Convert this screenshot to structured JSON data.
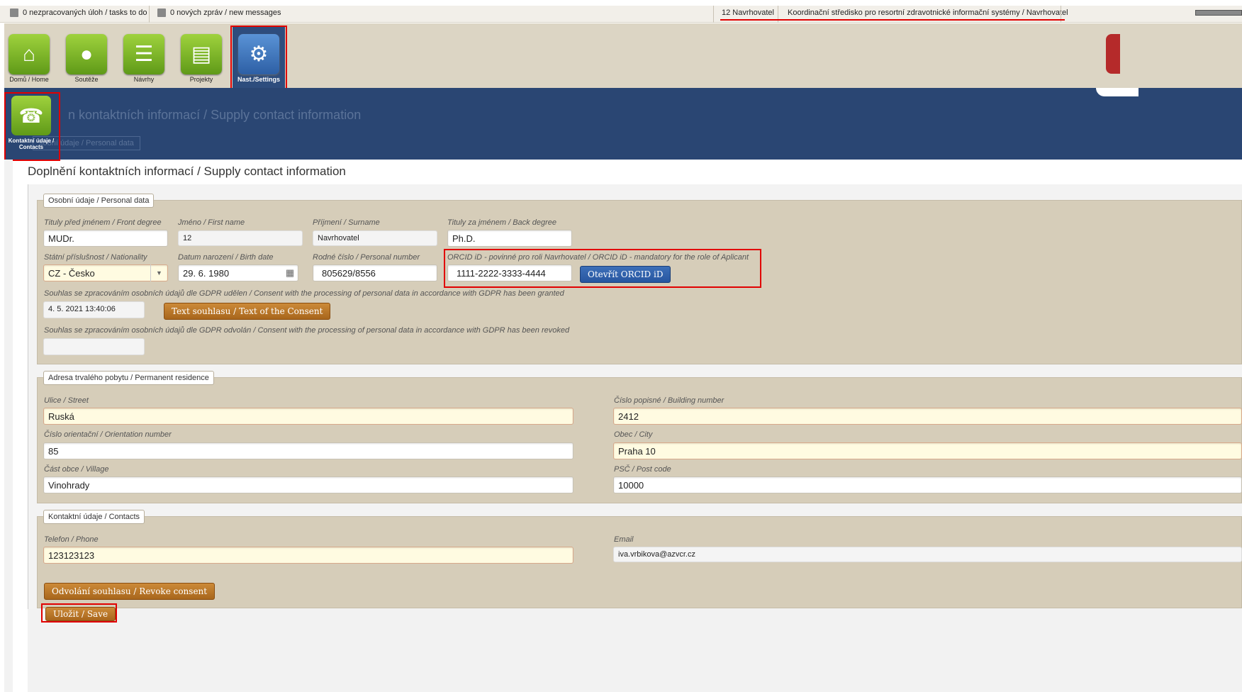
{
  "topbar": {
    "tasks": "0 nezpracovaných úloh / tasks to do",
    "messages": "0 nových zpráv / new messages",
    "user": "12 Navrhovatel",
    "org": "Koordinační středisko pro resortní zdravotnické informační systémy / Navrhovatel"
  },
  "toolbar": {
    "home": "Domů / Home",
    "competitions": "Soutěže",
    "proposals": "Návrhy",
    "projects": "Projekty",
    "settings": "Nast./Settings"
  },
  "subnav": {
    "contacts": "Kontaktní údaje / Contacts"
  },
  "band": {
    "title": "n kontaktních informací / Supply contact information",
    "chip": "sobní údaje / Personal data"
  },
  "page_title": "Doplnění kontaktních informací / Supply contact information",
  "personal": {
    "legend": "Osobní údaje / Personal data",
    "front_degree_label": "Tituly před jménem / Front degree",
    "front_degree": "MUDr.",
    "first_name_label": "Jméno / First name",
    "first_name": "12",
    "surname_label": "Příjmení / Surname",
    "surname": "Navrhovatel",
    "back_degree_label": "Tituly za jménem / Back degree",
    "back_degree": "Ph.D.",
    "nationality_label": "Státní příslušnost / Nationality",
    "nationality": "CZ - Česko",
    "birth_label": "Datum narození / Birth date",
    "birth": "29. 6. 1980",
    "pn_label": "Rodné číslo / Personal number",
    "pn": "805629/8556",
    "orcid_label": "ORCID iD - povinné pro roli Navrhovatel / ORCID iD - mandatory for the role of Aplicant",
    "orcid": "1111-2222-3333-4444",
    "orcid_button": "Otevřít ORCID iD",
    "gdpr_granted_label": "Souhlas se zpracováním osobních údajů dle GDPR udělen / Consent with the processing of personal data in accordance with GDPR has been granted",
    "gdpr_granted": "4. 5. 2021 13:40:06",
    "consent_button": "Text souhlasu / Text of the Consent",
    "gdpr_revoked_label": "Souhlas se zpracováním osobních údajů dle GDPR odvolán / Consent with the processing of personal data in accordance with GDPR has been revoked",
    "gdpr_revoked": ""
  },
  "address": {
    "legend": "Adresa trvalého pobytu / Permanent residence",
    "street_label": "Ulice / Street",
    "street": "Ruská",
    "building_label": "Číslo popisné / Building number",
    "building": "2412",
    "orientation_label": "Číslo orientační / Orientation number",
    "orientation": "85",
    "city_label": "Obec / City",
    "city": "Praha 10",
    "village_label": "Část obce / Village",
    "village": "Vinohrady",
    "postcode_label": "PSČ / Post code",
    "postcode": "10000"
  },
  "contacts": {
    "legend": "Kontaktní údaje / Contacts",
    "phone_label": "Telefon / Phone",
    "phone": "123123123",
    "email_label": "Email",
    "email": "iva.vrbikova@azvcr.cz",
    "revoke_button": "Odvolání souhlasu / Revoke consent"
  },
  "save_button": "Uložit / Save",
  "colors": {
    "accent_red": "#e10000",
    "header_blue": "#2a4673",
    "button_brown": "#b8732a",
    "button_blue": "#2f63ad"
  }
}
